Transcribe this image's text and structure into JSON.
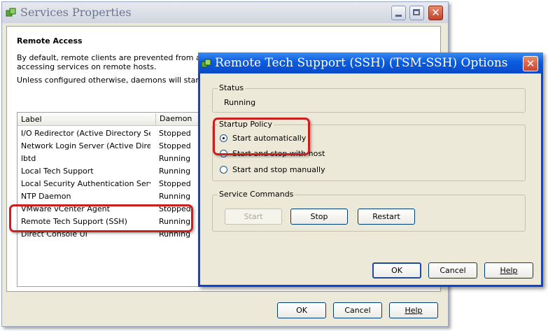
{
  "back_window": {
    "title": "Services Properties",
    "section_title": "Remote Access",
    "description_line1": "By default, remote clients are prevented from accessing",
    "description_line2": "accessing services on remote hosts.",
    "description_line3": "Unless configured otherwise, daemons will start automatically",
    "list": {
      "columns": [
        "Label",
        "Daemon"
      ],
      "rows": [
        {
          "label": "I/O Redirector (Active Directory Se...",
          "daemon": "Stopped"
        },
        {
          "label": "Network Login Server (Active Direc...",
          "daemon": "Stopped"
        },
        {
          "label": "lbtd",
          "daemon": "Running"
        },
        {
          "label": "Local Tech Support",
          "daemon": "Running"
        },
        {
          "label": "Local Security Authentication Serv...",
          "daemon": "Stopped"
        },
        {
          "label": "NTP Daemon",
          "daemon": "Running"
        },
        {
          "label": "VMware vCenter Agent",
          "daemon": "Stopped"
        },
        {
          "label": "Remote Tech Support (SSH)",
          "daemon": "Running"
        },
        {
          "label": "Direct Console UI",
          "daemon": "Running"
        }
      ]
    },
    "buttons": {
      "ok": "OK",
      "cancel": "Cancel",
      "help": "Help"
    }
  },
  "dialog": {
    "title": "Remote Tech Support (SSH) (TSM-SSH) Options",
    "status": {
      "legend": "Status",
      "value": "Running"
    },
    "startup_policy": {
      "legend": "Startup Policy",
      "options": [
        {
          "label": "Start automatically",
          "selected": true
        },
        {
          "label": "Start and stop with host",
          "selected": false
        },
        {
          "label": "Start and stop manually",
          "selected": false
        }
      ]
    },
    "service_commands": {
      "legend": "Service Commands",
      "start": "Start",
      "stop": "Stop",
      "restart": "Restart"
    },
    "buttons": {
      "ok": "OK",
      "cancel": "Cancel",
      "help": "Help"
    }
  },
  "colors": {
    "highlight": "#cc2020",
    "titlebar_active": "#0a5ce0",
    "titlebar_inactive": "#cfd5e0"
  }
}
